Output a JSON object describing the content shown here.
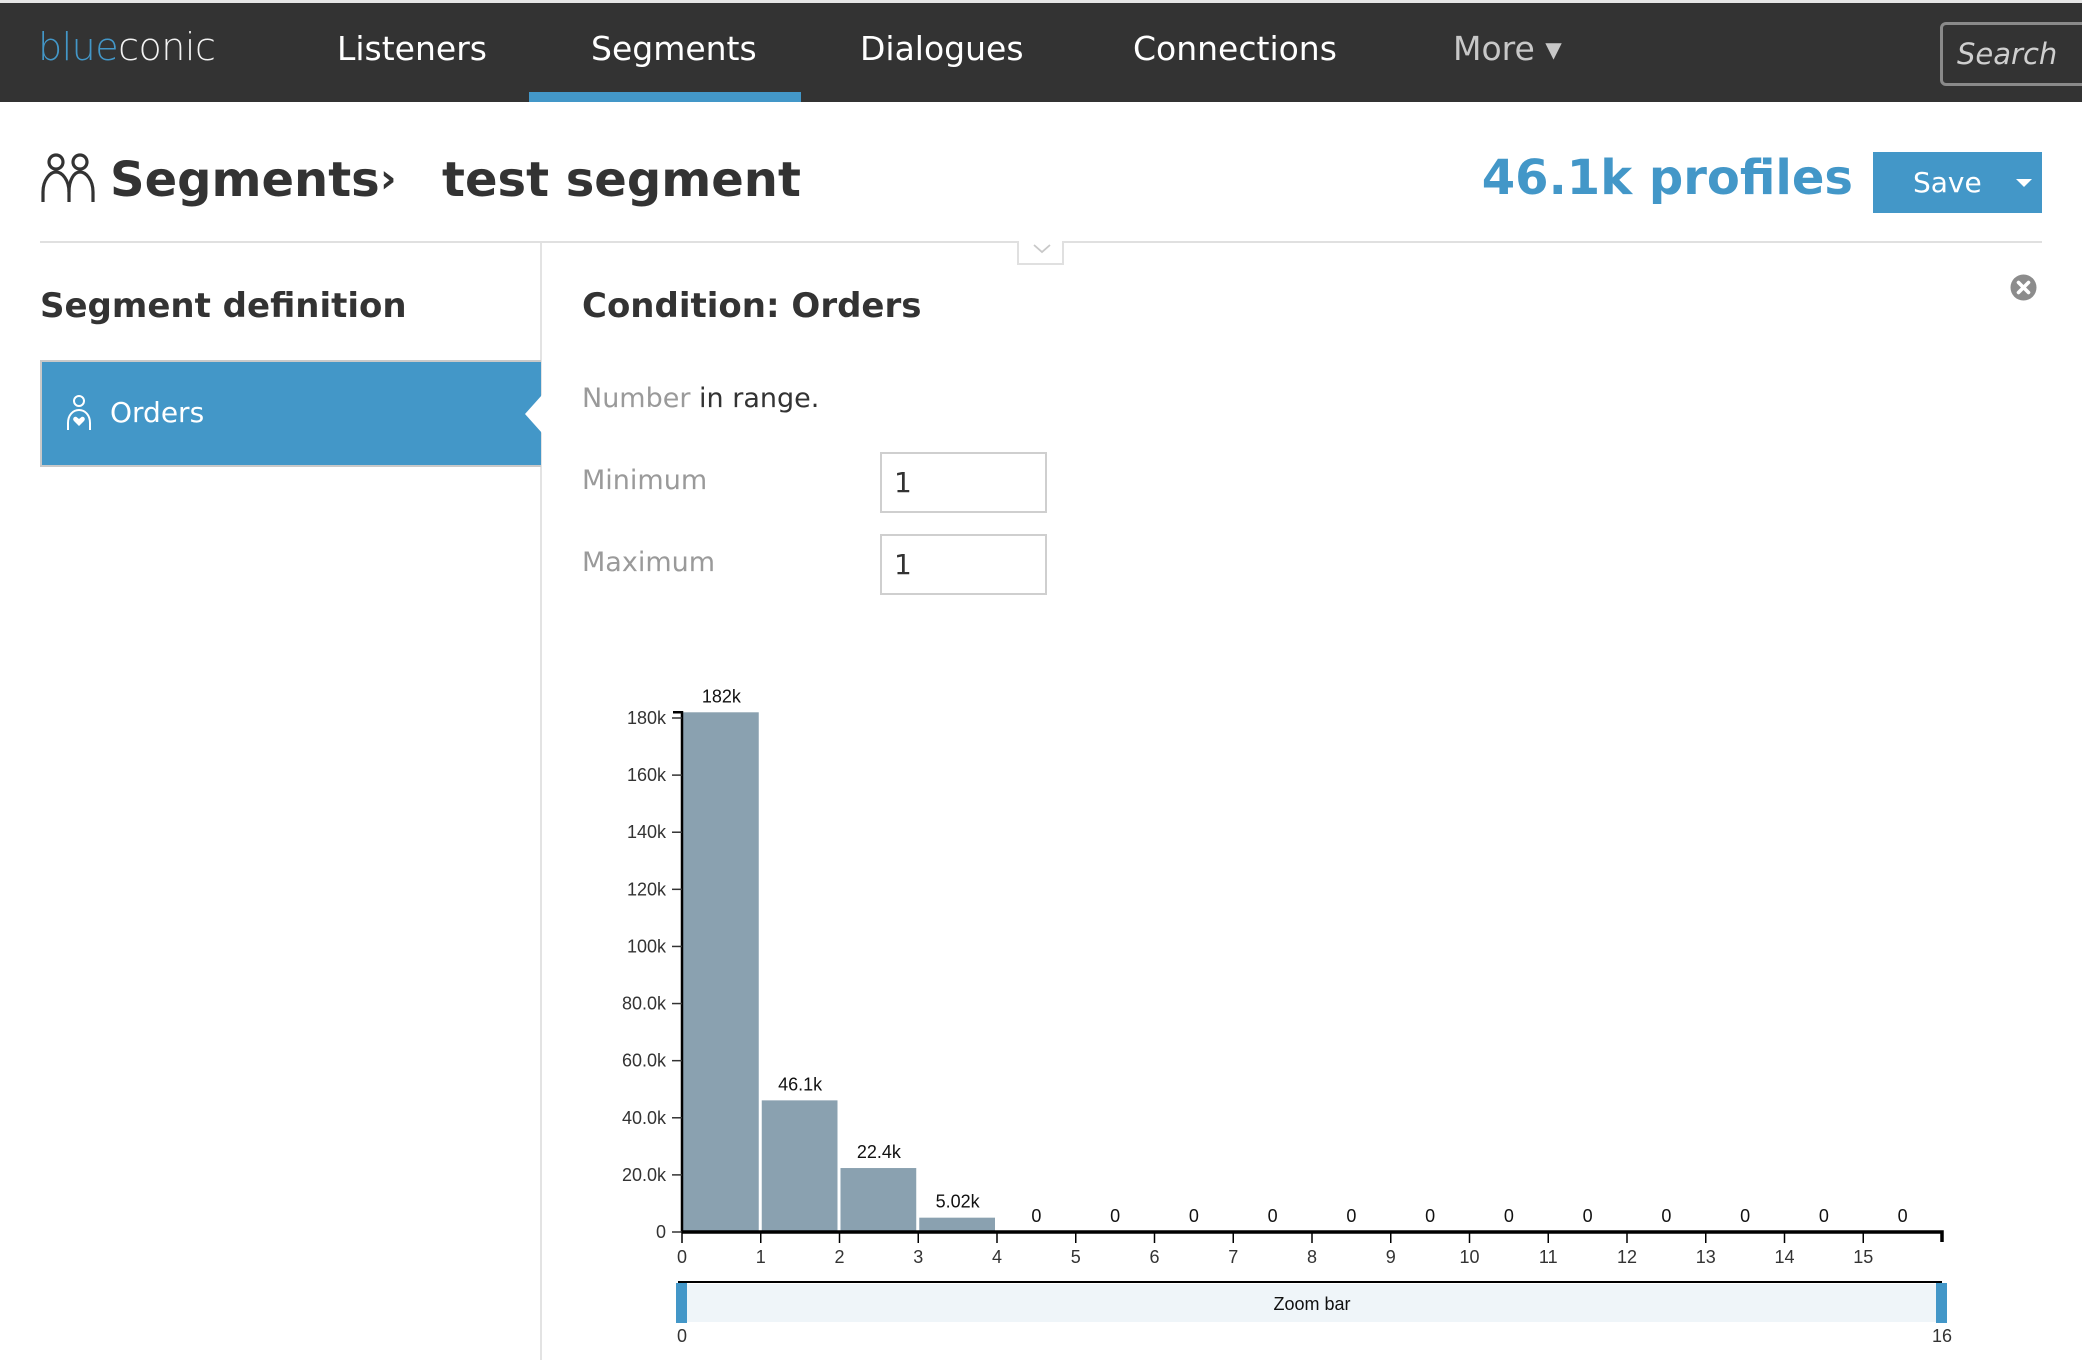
{
  "nav": {
    "logo_part1": "blue",
    "logo_part2": "conic",
    "items": [
      {
        "label": "Listeners",
        "active": false
      },
      {
        "label": "Segments",
        "active": true
      },
      {
        "label": "Dialogues",
        "active": false
      },
      {
        "label": "Connections",
        "active": false
      },
      {
        "label": "More ▾",
        "active": false
      }
    ],
    "search_placeholder": "Search"
  },
  "header": {
    "breadcrumb_root": "Segments",
    "breadcrumb_separator": "›",
    "breadcrumb_current": "test segment",
    "profiles_count": "46.1k profiles",
    "save_label": "Save"
  },
  "left_panel": {
    "title": "Segment definition",
    "conditions": [
      {
        "label": "Orders",
        "icon": "person-heart-icon",
        "selected": true
      }
    ]
  },
  "condition": {
    "title": "Condition: Orders",
    "rule_type": "Number",
    "rule_text": " in range.",
    "minimum_label": "Minimum",
    "minimum_value": "1",
    "maximum_label": "Maximum",
    "maximum_value": "1"
  },
  "colors": {
    "accent": "#4397c8",
    "nav_bg": "#333333",
    "bar": "#8aa1b0",
    "zoom_bar_bg": "#eff5f9"
  },
  "chart_data": {
    "type": "bar",
    "title": "",
    "xlabel": "",
    "ylabel": "",
    "bins": [
      {
        "x0": 0,
        "x1": 1,
        "value": 182000,
        "label": "182k"
      },
      {
        "x0": 1,
        "x1": 2,
        "value": 46100,
        "label": "46.1k"
      },
      {
        "x0": 2,
        "x1": 3,
        "value": 22400,
        "label": "22.4k"
      },
      {
        "x0": 3,
        "x1": 4,
        "value": 5020,
        "label": "5.02k"
      },
      {
        "x0": 4,
        "x1": 5,
        "value": 0,
        "label": "0"
      },
      {
        "x0": 5,
        "x1": 6,
        "value": 0,
        "label": "0"
      },
      {
        "x0": 6,
        "x1": 7,
        "value": 0,
        "label": "0"
      },
      {
        "x0": 7,
        "x1": 8,
        "value": 0,
        "label": "0"
      },
      {
        "x0": 8,
        "x1": 9,
        "value": 0,
        "label": "0"
      },
      {
        "x0": 9,
        "x1": 10,
        "value": 0,
        "label": "0"
      },
      {
        "x0": 10,
        "x1": 11,
        "value": 0,
        "label": "0"
      },
      {
        "x0": 11,
        "x1": 12,
        "value": 0,
        "label": "0"
      },
      {
        "x0": 12,
        "x1": 13,
        "value": 0,
        "label": "0"
      },
      {
        "x0": 13,
        "x1": 14,
        "value": 0,
        "label": "0"
      },
      {
        "x0": 14,
        "x1": 15,
        "value": 0,
        "label": "0"
      },
      {
        "x0": 15,
        "x1": 16,
        "value": 0,
        "label": "0"
      }
    ],
    "xlim": [
      0,
      16
    ],
    "ylim": [
      0,
      182000
    ],
    "x_ticks": [
      0,
      1,
      2,
      3,
      4,
      5,
      6,
      7,
      8,
      9,
      10,
      11,
      12,
      13,
      14,
      15
    ],
    "y_ticks": [
      {
        "value": 0,
        "label": "0"
      },
      {
        "value": 20000,
        "label": "20.0k"
      },
      {
        "value": 40000,
        "label": "40.0k"
      },
      {
        "value": 60000,
        "label": "60.0k"
      },
      {
        "value": 80000,
        "label": "80.0k"
      },
      {
        "value": 100000,
        "label": "100k"
      },
      {
        "value": 120000,
        "label": "120k"
      },
      {
        "value": 140000,
        "label": "140k"
      },
      {
        "value": 160000,
        "label": "160k"
      },
      {
        "value": 180000,
        "label": "180k"
      }
    ],
    "grid": false,
    "zoom_bar": {
      "label": "Zoom bar",
      "min_label": "0",
      "max_label": "16",
      "range": [
        0,
        16
      ]
    }
  }
}
